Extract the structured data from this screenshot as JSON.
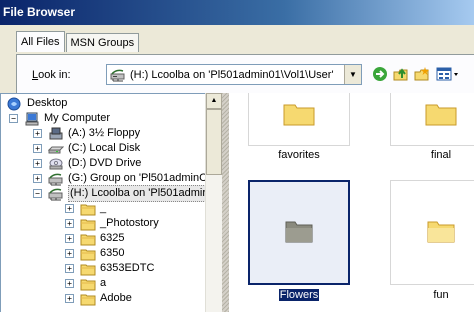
{
  "window": {
    "title": "File Browser"
  },
  "tabs": [
    {
      "label": "All Files",
      "active": true
    },
    {
      "label": "MSN Groups",
      "active": false
    }
  ],
  "lookin": {
    "label_first": "L",
    "label_rest": "ook in:",
    "value": "(H:) Lcoolba on 'Pl501admin01\\Vol1\\User'"
  },
  "toolbar": {
    "icons": [
      "go-icon",
      "up-folder-icon",
      "new-folder-icon",
      "views-menu-icon"
    ]
  },
  "tree": {
    "items": [
      {
        "label": "Desktop",
        "icon": "desktop-icon",
        "expander": "",
        "level": 0
      },
      {
        "label": "My Computer",
        "icon": "my-computer-icon",
        "expander": "−",
        "level": 1
      },
      {
        "label": "(A:) 3½ Floppy",
        "icon": "floppy-icon",
        "expander": "+",
        "level": 2
      },
      {
        "label": "(C:) Local Disk",
        "icon": "hard-disk-icon",
        "expander": "+",
        "level": 2
      },
      {
        "label": "(D:) DVD Drive",
        "icon": "dvd-drive-icon",
        "expander": "+",
        "level": 2
      },
      {
        "label": "(G:) Group on 'Pl501adminC",
        "icon": "network-drive-icon",
        "expander": "+",
        "level": 2
      },
      {
        "label": "(H:) Lcoolba on 'Pl501admir",
        "icon": "network-drive-icon",
        "expander": "−",
        "level": 2,
        "selected": true
      },
      {
        "label": "_",
        "icon": "folder-icon",
        "expander": "+",
        "level": 3
      },
      {
        "label": "_Photostory",
        "icon": "folder-icon",
        "expander": "+",
        "level": 3
      },
      {
        "label": "6325",
        "icon": "folder-icon",
        "expander": "+",
        "level": 3
      },
      {
        "label": "6350",
        "icon": "folder-icon",
        "expander": "+",
        "level": 3
      },
      {
        "label": "6353EDTC",
        "icon": "folder-icon",
        "expander": "+",
        "level": 3
      },
      {
        "label": "a",
        "icon": "folder-icon",
        "expander": "+",
        "level": 3
      },
      {
        "label": "Adobe",
        "icon": "folder-icon",
        "expander": "+",
        "level": 3
      }
    ]
  },
  "files": [
    {
      "label": "favorites",
      "selected": false
    },
    {
      "label": "final",
      "selected": false
    },
    {
      "label": "Flowers",
      "selected": true
    },
    {
      "label": "fun",
      "selected": false
    }
  ],
  "colors": {
    "title_start": "#0a246a",
    "title_end": "#a6caf0",
    "selection": "#0a246a",
    "folder": "#f6d970"
  }
}
